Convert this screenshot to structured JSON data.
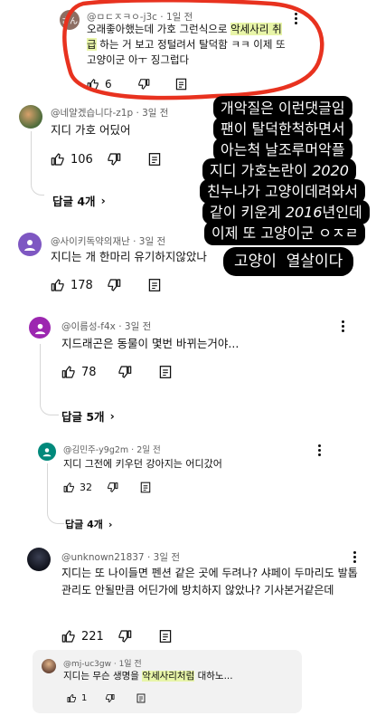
{
  "comments": [
    {
      "handle": "@ㅁㄷㅈㅋㅇ-j3c",
      "time": "1일 전",
      "avatar_text": "さん",
      "text_1": "오래좋아했는데 가호 그런식으로 ",
      "text_hl": "악세사리 취급",
      "text_2": " 하는 거 보고 정털려서 탈덕함 ㅋㅋ 이제 또 고양이군 아ㅜ 징그럽다",
      "likes": "6"
    },
    {
      "handle": "@네얄겠습니다-z1p",
      "time": "3일 전",
      "text": "지디 가호 어딨어",
      "likes": "106",
      "replies": "답글 4개"
    },
    {
      "handle": "@사이키독약의재난",
      "time": "3일 전",
      "text": "지디는 개 한마리 유기하지않았나",
      "likes": "178"
    },
    {
      "handle": "@이름성-f4x",
      "time": "3일 전",
      "text": "지드래곤은 동물이 몇번 바뀌는거야...",
      "likes": "78",
      "replies": "답글 5개"
    },
    {
      "handle": "@김민주-y9g2m",
      "time": "2일 전",
      "text": "지디 그전에 키우던 강아지는 어디갔어",
      "likes": "32",
      "replies": "답글 4개"
    },
    {
      "handle": "@unknown21837",
      "time": "3일 전",
      "text": "지디는 또 나이들면 펜션 같은 곳에 두려나? 샤페이 두마리도 발톱 관리도 안될만큼 어딘가에 방치하지 않았나? 기사본거같은데",
      "likes": "221"
    },
    {
      "handle": "@mj-uc3gw",
      "time": "1일 전",
      "text_1": "지디는 무슨 생명을 ",
      "text_hl": "악세사리처럼",
      "text_2": " 대하노...",
      "likes": "1"
    }
  ],
  "overlay_caption": {
    "line1": "개악질은 이런댓글임",
    "line2": "팬이 탈덕한척하면서",
    "line3": "아는척 날조루머악플",
    "line4a": "지디 가호논란이 ",
    "line4b": "2020",
    "line5": "친누나가 고양이데려와서",
    "line6a": "같이 키운게 ",
    "line6b": "2016",
    "line6c": "년인데",
    "line7": "이제 또 고양이군 ㅇㅈㄹ"
  },
  "overlay_tag": "고양이  열살이다",
  "colors": {
    "annotation_red": "#e8321f",
    "highlight": "#e8f5a8",
    "overlay_bg": "#000000"
  }
}
